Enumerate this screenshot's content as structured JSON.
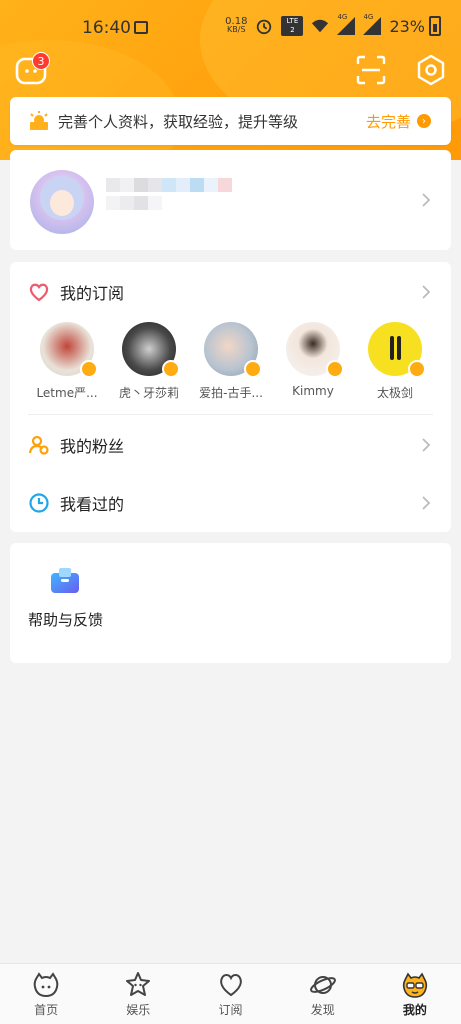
{
  "status_bar": {
    "time": "16:40",
    "net_speed": "0.18",
    "net_unit": "KB/S",
    "volte": "LTE 2",
    "signal1": "4G",
    "signal2": "4G",
    "battery": "23%"
  },
  "header": {
    "message_badge": "3",
    "icons": [
      "message-icon",
      "scan-icon",
      "settings-icon"
    ]
  },
  "banner": {
    "text": "完善个人资料，获取经验，提升等级",
    "link": "去完善"
  },
  "subscriptions": {
    "title": "我的订阅",
    "items": [
      {
        "name": "Letme严..."
      },
      {
        "name": "虎丶牙莎莉"
      },
      {
        "name": "爱拍-古手..."
      },
      {
        "name": "Kimmy"
      },
      {
        "name": "太极剑"
      }
    ]
  },
  "menu": {
    "fans": "我的粉丝",
    "watched": "我看过的"
  },
  "help": {
    "label": "帮助与反馈"
  },
  "tabbar": {
    "tabs": [
      {
        "label": "首页"
      },
      {
        "label": "娱乐"
      },
      {
        "label": "订阅"
      },
      {
        "label": "发现"
      },
      {
        "label": "我的"
      }
    ],
    "active": "我的"
  },
  "colors": {
    "accent": "#ff9a00",
    "header_bg": "#ffa10d",
    "badge": "#ff3b30"
  }
}
